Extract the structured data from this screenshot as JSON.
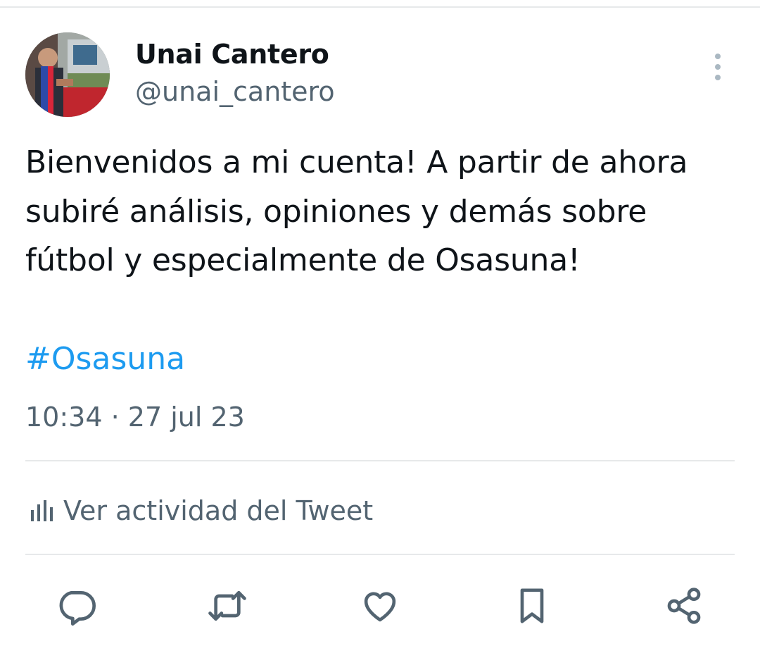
{
  "tweet": {
    "author": {
      "display_name": "Unai Cantero",
      "handle": "@unai_cantero"
    },
    "text": "Bienvenidos a mi cuenta! A partir de ahora subiré análisis, opiniones y demás sobre fútbol y especialmente de Osasuna!",
    "hashtag": "#Osasuna",
    "time": "10:34",
    "separator": "·",
    "date": "27 jul 23"
  },
  "activity": {
    "label": "Ver actividad del Tweet",
    "icon": "analytics-icon"
  },
  "actions": [
    {
      "icon": "reply-icon"
    },
    {
      "icon": "retweet-icon"
    },
    {
      "icon": "like-icon"
    },
    {
      "icon": "bookmark-icon"
    },
    {
      "icon": "share-icon"
    }
  ],
  "menu_icon": "more-vertical-icon",
  "colors": {
    "text_primary": "#0f1419",
    "text_secondary": "#536471",
    "link": "#1d9bf0",
    "divider": "#e7e9ea",
    "background": "#ffffff"
  }
}
